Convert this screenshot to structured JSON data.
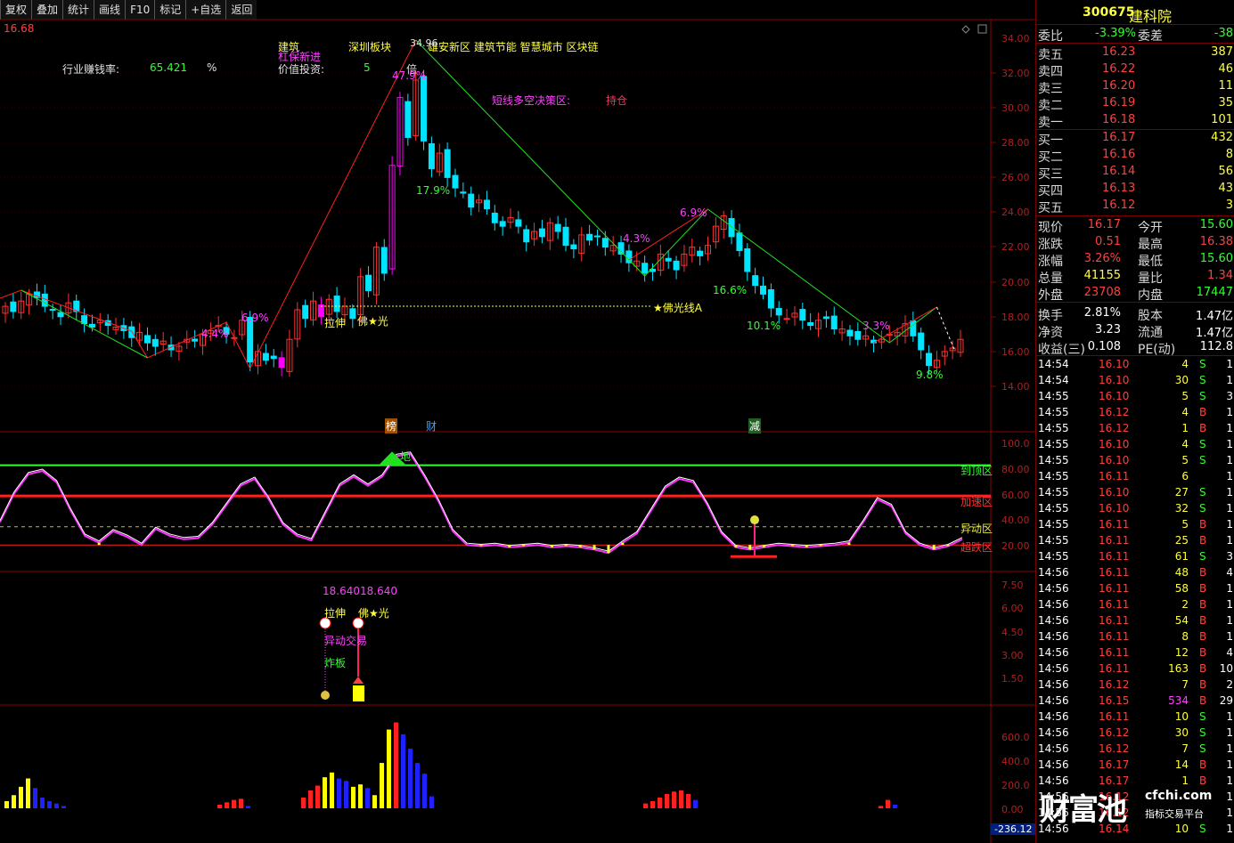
{
  "toolbar": [
    "复权",
    "叠加",
    "统计",
    "画线",
    "F10",
    "标记",
    "+自选",
    "返回"
  ],
  "stock": {
    "code": "300675",
    "name": "建科院"
  },
  "top_left_value": "16.68",
  "info": {
    "label_industry": "行业赚钱率:",
    "industry_value": "65.421",
    "pct": "%",
    "label_sector_a": "建筑",
    "label_sector_b": "深圳板块",
    "label_extra": "杠保新进",
    "label_value": "价值投资:",
    "value_num": "5",
    "label_bei": "倍",
    "concepts": "雄安新区 建筑节能 智慧城市 区块链",
    "short_label": "短线多空决策区:",
    "short_value": "持仓",
    "peak_price": "34.96"
  },
  "annotations": {
    "p479": "47.9%",
    "p179": "17.9%",
    "p43": "4.3%",
    "p69b": "6.9%",
    "p166": "16.6%",
    "p101": "10.1%",
    "p33": "3.3%",
    "p98": "9.8%",
    "p69a": "6.9%",
    "p44": "4.4%",
    "lashen": "拉伸",
    "foguang": "佛★光",
    "foguangline": "★佛光线A",
    "bang": "榜",
    "cai": "财",
    "jian": "减",
    "di": "地"
  },
  "price_axis": [
    "34.00",
    "32.00",
    "30.00",
    "28.00",
    "26.00",
    "24.00",
    "22.00",
    "20.00",
    "18.00",
    "16.00",
    "14.00"
  ],
  "osc_axis": [
    "100.0",
    "80.00",
    "60.00",
    "40.00",
    "20.00"
  ],
  "osc_zones": {
    "top": "到顶区",
    "accel": "加速区",
    "abnormal": "异动区",
    "oversold": "超跌区"
  },
  "sig_axis": [
    "7.50",
    "6.00",
    "4.50",
    "3.00",
    "1.50"
  ],
  "sig_labels": {
    "value": "18.64018.640",
    "lashen": "拉伸",
    "foguang": "佛★光",
    "yidong": "异动交易",
    "zhaban": "炸板"
  },
  "vol_axis": [
    "600.0",
    "400.0",
    "200.0",
    "0.00"
  ],
  "vol_min": "-236.12",
  "quote": {
    "weibi_label": "委比",
    "weibi": "-3.39%",
    "weicha_label": "委差",
    "weicha": "-38",
    "asks": [
      {
        "label": "卖五",
        "price": "16.23",
        "vol": "387"
      },
      {
        "label": "卖四",
        "price": "16.22",
        "vol": "46"
      },
      {
        "label": "卖三",
        "price": "16.20",
        "vol": "11"
      },
      {
        "label": "卖二",
        "price": "16.19",
        "vol": "35"
      },
      {
        "label": "卖一",
        "price": "16.18",
        "vol": "101"
      }
    ],
    "bids": [
      {
        "label": "买一",
        "price": "16.17",
        "vol": "432"
      },
      {
        "label": "买二",
        "price": "16.16",
        "vol": "8"
      },
      {
        "label": "买三",
        "price": "16.14",
        "vol": "56"
      },
      {
        "label": "买四",
        "price": "16.13",
        "vol": "43"
      },
      {
        "label": "买五",
        "price": "16.12",
        "vol": "3"
      }
    ],
    "stats": [
      {
        "l1": "现价",
        "v1": "16.17",
        "c1": "red",
        "l2": "今开",
        "v2": "15.60",
        "c2": "green"
      },
      {
        "l1": "涨跌",
        "v1": "0.51",
        "c1": "red",
        "l2": "最高",
        "v2": "16.38",
        "c2": "red"
      },
      {
        "l1": "涨幅",
        "v1": "3.26%",
        "c1": "red",
        "l2": "最低",
        "v2": "15.60",
        "c2": "green"
      },
      {
        "l1": "总量",
        "v1": "41155",
        "c1": "yellow",
        "l2": "量比",
        "v2": "1.34",
        "c2": "red"
      },
      {
        "l1": "外盘",
        "v1": "23708",
        "c1": "red",
        "l2": "内盘",
        "v2": "17447",
        "c2": "green"
      },
      {
        "l1": "换手",
        "v1": "2.81%",
        "c1": "white",
        "l2": "股本",
        "v2": "1.47亿",
        "c2": "white"
      },
      {
        "l1": "净资",
        "v1": "3.23",
        "c1": "white",
        "l2": "流通",
        "v2": "1.47亿",
        "c2": "white"
      },
      {
        "l1": "收益(三)",
        "v1": "0.108",
        "c1": "white",
        "l2": "PE(动)",
        "v2": "112.8",
        "c2": "white"
      }
    ]
  },
  "ticks": [
    [
      "14:54",
      "16.10",
      "4",
      "S"
    ],
    [
      "14:54",
      "16.10",
      "30",
      "S"
    ],
    [
      "14:55",
      "16.10",
      "5",
      "S"
    ],
    [
      "14:55",
      "16.12",
      "4",
      "B"
    ],
    [
      "14:55",
      "16.12",
      "1",
      "B"
    ],
    [
      "14:55",
      "16.10",
      "4",
      "S"
    ],
    [
      "14:55",
      "16.10",
      "5",
      "S"
    ],
    [
      "14:55",
      "16.11",
      "6",
      ""
    ],
    [
      "14:55",
      "16.10",
      "27",
      "S"
    ],
    [
      "14:55",
      "16.10",
      "32",
      "S"
    ],
    [
      "14:55",
      "16.11",
      "5",
      "B"
    ],
    [
      "14:55",
      "16.11",
      "25",
      "B"
    ],
    [
      "14:55",
      "16.11",
      "61",
      "S"
    ],
    [
      "14:56",
      "16.11",
      "48",
      "B"
    ],
    [
      "14:56",
      "16.11",
      "58",
      "B"
    ],
    [
      "14:56",
      "16.11",
      "2",
      "B"
    ],
    [
      "14:56",
      "16.11",
      "54",
      "B"
    ],
    [
      "14:56",
      "16.11",
      "8",
      "B"
    ],
    [
      "14:56",
      "16.11",
      "12",
      "B"
    ],
    [
      "14:56",
      "16.11",
      "163",
      "B"
    ],
    [
      "14:56",
      "16.12",
      "7",
      "B"
    ],
    [
      "14:56",
      "16.15",
      "534",
      "B"
    ],
    [
      "14:56",
      "16.11",
      "10",
      "S"
    ],
    [
      "14:56",
      "16.12",
      "30",
      "S"
    ],
    [
      "14:56",
      "16.12",
      "7",
      "S"
    ],
    [
      "14:56",
      "16.17",
      "14",
      "B"
    ],
    [
      "14:56",
      "16.17",
      "1",
      "B"
    ],
    [
      "14:56",
      "16.12",
      "",
      ""
    ],
    [
      "14:56",
      "16.12",
      "",
      ""
    ],
    [
      "14:56",
      "16.14",
      "10",
      "S"
    ]
  ],
  "tick_tail": [
    "1",
    "1",
    "3",
    "1",
    "1",
    "1",
    "1",
    "1",
    "1",
    "1",
    "1",
    "1",
    "3",
    "4",
    "1",
    "1",
    "1",
    "1",
    "4",
    "10",
    "2",
    "29",
    "1",
    "1",
    "1",
    "1",
    "1",
    "1",
    "1",
    "1"
  ],
  "logo": {
    "main": "财富池",
    "site": "cfchi.com",
    "sub": "指标交易平台"
  },
  "colors": {
    "up": "#ff3030",
    "down": "#00e5ff",
    "hot": "#ff00ff",
    "vol_up": "#ffff00",
    "vol_down": "#2020ff"
  }
}
